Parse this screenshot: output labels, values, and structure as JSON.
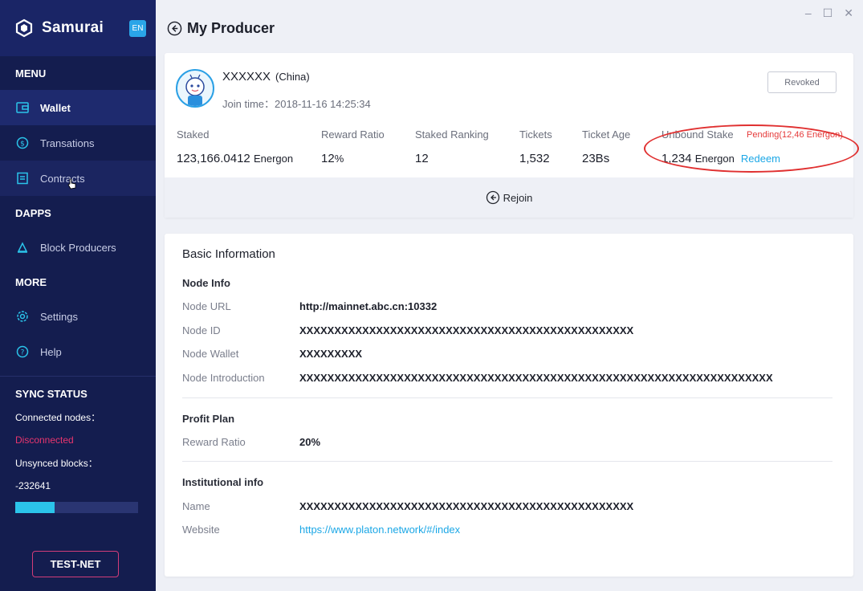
{
  "app": {
    "name": "Samurai",
    "lang": "EN"
  },
  "sidebar": {
    "menu_title": "MENU",
    "menu_items": [
      {
        "label": "Wallet",
        "icon": "wallet-icon"
      },
      {
        "label": "Transations",
        "icon": "coin-icon"
      },
      {
        "label": "Contracts",
        "icon": "contract-icon"
      }
    ],
    "dapps_title": "DAPPS",
    "dapps_items": [
      {
        "label": "Block Producers",
        "icon": "block-producers-icon"
      }
    ],
    "more_title": "MORE",
    "more_items": [
      {
        "label": "Settings",
        "icon": "gear-icon"
      },
      {
        "label": "Help",
        "icon": "help-icon"
      }
    ],
    "sync": {
      "title": "SYNC STATUS",
      "connected_label": "Connected nodes：",
      "connected_value": "Disconnected",
      "unsynced_label": "Unsynced blocks：",
      "unsynced_value": "-232641",
      "progress": 0.32
    },
    "network_label": "TEST-NET"
  },
  "header": {
    "title": "My Producer"
  },
  "producer": {
    "name": "XXXXXX",
    "country": "(China)",
    "join_time": "Join time：2018-11-16 14:25:34",
    "revoked_label": "Revoked",
    "stats": {
      "staked_label": "Staked",
      "staked_value": "123,166.0412",
      "staked_unit": "Energon",
      "reward_label": "Reward Ratio",
      "reward_value": "12",
      "reward_unit": "%",
      "ranking_label": "Staked Ranking",
      "ranking_value": "12",
      "tickets_label": "Tickets",
      "tickets_value": "1,532",
      "age_label": "Ticket Age",
      "age_value": "23Bs",
      "unbound_label": "Unbound Stake",
      "unbound_value": "1,234",
      "unbound_unit": "Energon",
      "pending": "Pending(12,46 Energon)",
      "redeem_label": "Redeem"
    },
    "rejoin_label": "Rejoin"
  },
  "info": {
    "title": "Basic Information",
    "node_info_title": "Node Info",
    "node_url_label": "Node URL",
    "node_url_value": "http://mainnet.abc.cn:10332",
    "node_id_label": "Node ID",
    "node_id_value": "XXXXXXXXXXXXXXXXXXXXXXXXXXXXXXXXXXXXXXXXXXXXXXXX",
    "node_wallet_label": "Node Wallet",
    "node_wallet_value": "XXXXXXXXX",
    "node_intro_label": "Node Introduction",
    "node_intro_value": "XXXXXXXXXXXXXXXXXXXXXXXXXXXXXXXXXXXXXXXXXXXXXXXXXXXXXXXXXXXXXXXXXXXX",
    "profit_title": "Profit Plan",
    "profit_reward_label": "Reward Ratio",
    "profit_reward_value": "20%",
    "institution_title": "Institutional info",
    "name_label": "Name",
    "name_value": "XXXXXXXXXXXXXXXXXXXXXXXXXXXXXXXXXXXXXXXXXXXXXXXX",
    "website_label": "Website",
    "website_value": "https://www.platon.network/#/index"
  },
  "colors": {
    "sidebar_bg": "#141d4f",
    "accent": "#1ba7e6",
    "danger": "#e53a3a",
    "brand_pink": "#d23c78"
  }
}
